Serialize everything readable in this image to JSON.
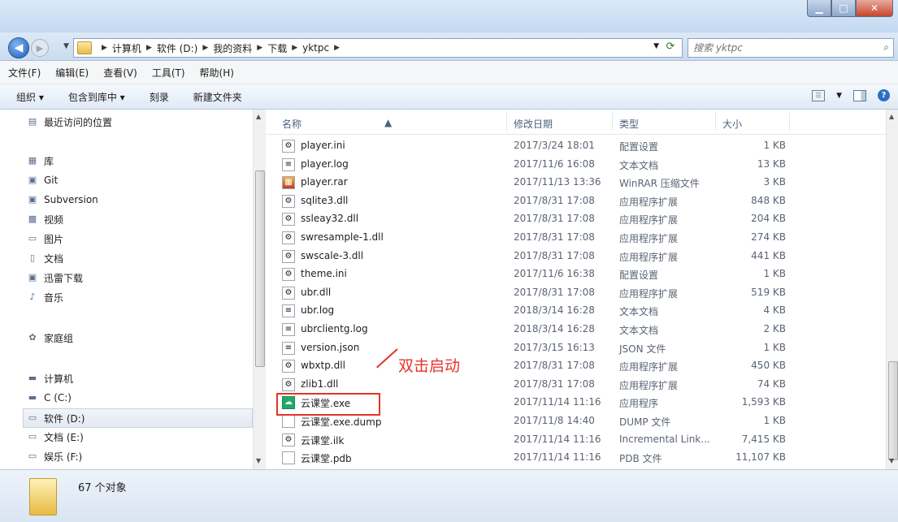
{
  "window": {
    "minimize_label": "▁",
    "maximize_label": "□",
    "close_label": "✕"
  },
  "address": {
    "crumbs": [
      "计算机",
      "软件 (D:)",
      "我的资料",
      "下载",
      "yktpc"
    ]
  },
  "search": {
    "placeholder": "搜索 yktpc"
  },
  "menu": [
    "文件(F)",
    "编辑(E)",
    "查看(V)",
    "工具(T)",
    "帮助(H)"
  ],
  "toolbar": {
    "organize": "组织 ▾",
    "include_library": "包含到库中 ▾",
    "burn": "刻录",
    "new_folder": "新建文件夹"
  },
  "nav": [
    {
      "label": "最近访问的位置",
      "icon": "recent-places-icon"
    },
    {
      "label": "库",
      "icon": "library-icon"
    },
    {
      "label": "Git",
      "icon": "git-library-icon"
    },
    {
      "label": "Subversion",
      "icon": "subversion-library-icon"
    },
    {
      "label": "视频",
      "icon": "video-library-icon"
    },
    {
      "label": "图片",
      "icon": "pictures-library-icon"
    },
    {
      "label": "文档",
      "icon": "documents-library-icon"
    },
    {
      "label": "迅雷下载",
      "icon": "thunder-download-icon"
    },
    {
      "label": "音乐",
      "icon": "music-library-icon"
    },
    {
      "label": "家庭组",
      "icon": "homegroup-icon"
    },
    {
      "label": "计算机",
      "icon": "computer-icon"
    },
    {
      "label": "C (C:)",
      "icon": "drive-c-icon"
    },
    {
      "label": "软件 (D:)",
      "icon": "drive-d-icon",
      "selected": true
    },
    {
      "label": "文档 (E:)",
      "icon": "drive-e-icon"
    },
    {
      "label": "娱乐 (F:)",
      "icon": "drive-f-icon"
    }
  ],
  "columns": [
    "名称",
    "修改日期",
    "类型",
    "大小"
  ],
  "files": [
    {
      "name": "player.ini",
      "date": "2017/3/24 18:01",
      "type": "配置设置",
      "size": "1 KB",
      "icon": "ini-file-icon"
    },
    {
      "name": "player.log",
      "date": "2017/11/6 16:08",
      "type": "文本文档",
      "size": "13 KB",
      "icon": "text-file-icon"
    },
    {
      "name": "player.rar",
      "date": "2017/11/13 13:36",
      "type": "WinRAR 压缩文件",
      "size": "3 KB",
      "icon": "rar-file-icon"
    },
    {
      "name": "sqlite3.dll",
      "date": "2017/8/31 17:08",
      "type": "应用程序扩展",
      "size": "848 KB",
      "icon": "dll-file-icon"
    },
    {
      "name": "ssleay32.dll",
      "date": "2017/8/31 17:08",
      "type": "应用程序扩展",
      "size": "204 KB",
      "icon": "dll-file-icon"
    },
    {
      "name": "swresample-1.dll",
      "date": "2017/8/31 17:08",
      "type": "应用程序扩展",
      "size": "274 KB",
      "icon": "dll-file-icon"
    },
    {
      "name": "swscale-3.dll",
      "date": "2017/8/31 17:08",
      "type": "应用程序扩展",
      "size": "441 KB",
      "icon": "dll-file-icon"
    },
    {
      "name": "theme.ini",
      "date": "2017/11/6 16:38",
      "type": "配置设置",
      "size": "1 KB",
      "icon": "ini-file-icon"
    },
    {
      "name": "ubr.dll",
      "date": "2017/8/31 17:08",
      "type": "应用程序扩展",
      "size": "519 KB",
      "icon": "dll-file-icon"
    },
    {
      "name": "ubr.log",
      "date": "2018/3/14 16:28",
      "type": "文本文档",
      "size": "4 KB",
      "icon": "text-file-icon"
    },
    {
      "name": "ubrclientg.log",
      "date": "2018/3/14 16:28",
      "type": "文本文档",
      "size": "2 KB",
      "icon": "text-file-icon"
    },
    {
      "name": "version.json",
      "date": "2017/3/15 16:13",
      "type": "JSON 文件",
      "size": "1 KB",
      "icon": "json-file-icon"
    },
    {
      "name": "wbxtp.dll",
      "date": "2017/8/31 17:08",
      "type": "应用程序扩展",
      "size": "450 KB",
      "icon": "dll-file-icon"
    },
    {
      "name": "zlib1.dll",
      "date": "2017/8/31 17:08",
      "type": "应用程序扩展",
      "size": "74 KB",
      "icon": "dll-file-icon"
    },
    {
      "name": "云课堂.exe",
      "date": "2017/11/14 11:16",
      "type": "应用程序",
      "size": "1,593 KB",
      "icon": "app-exe-icon"
    },
    {
      "name": "云课堂.exe.dump",
      "date": "2017/11/8 14:40",
      "type": "DUMP 文件",
      "size": "1 KB",
      "icon": "blank-file-icon"
    },
    {
      "name": "云课堂.ilk",
      "date": "2017/11/14 11:16",
      "type": "Incremental Link...",
      "size": "7,415 KB",
      "icon": "ilk-file-icon"
    },
    {
      "name": "云课堂.pdb",
      "date": "2017/11/14 11:16",
      "type": "PDB 文件",
      "size": "11,107 KB",
      "icon": "blank-file-icon"
    }
  ],
  "annotation": {
    "text": "双击启动",
    "color": "#e5332a"
  },
  "status": {
    "count": "67 个对象"
  }
}
